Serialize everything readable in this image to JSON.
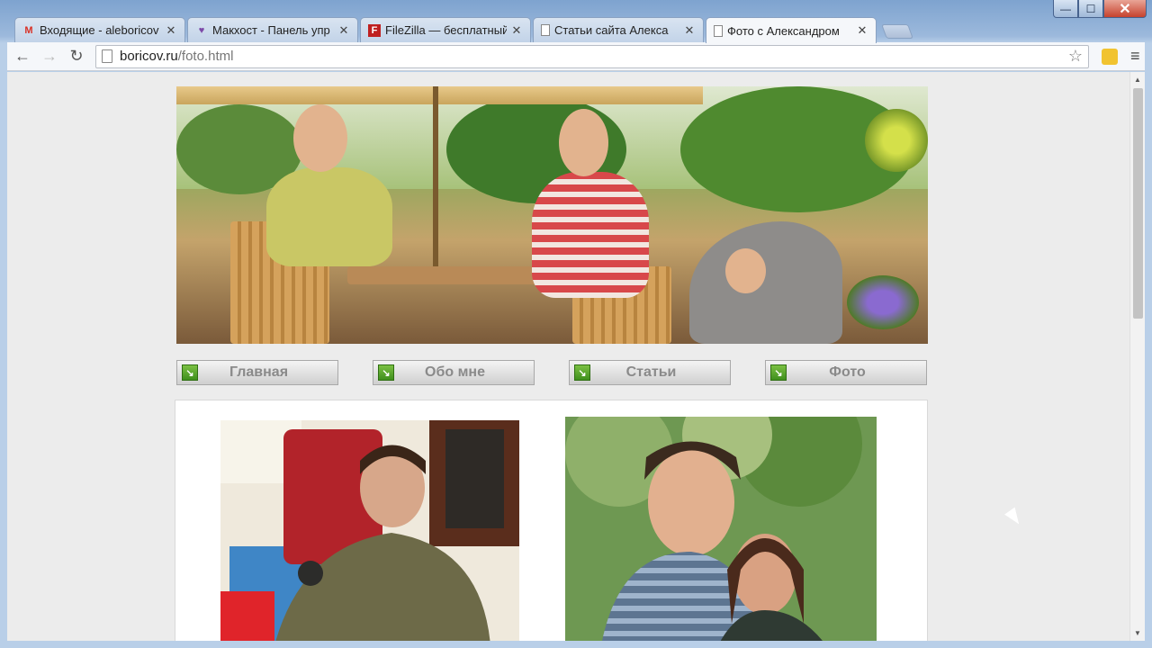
{
  "window": {
    "controls": {
      "minimize": "—",
      "maximize": "☐",
      "close": "✕"
    }
  },
  "tabs": [
    {
      "title": "Входящие - aleboricov",
      "icon": "gmail-icon",
      "active": false
    },
    {
      "title": "Макхост - Панель упр",
      "icon": "heart-icon",
      "active": false
    },
    {
      "title": "FileZilla — бесплатный",
      "icon": "filezilla-icon",
      "active": false
    },
    {
      "title": "Статьи сайта Алекса",
      "icon": "page-icon",
      "active": false
    },
    {
      "title": "Фото с Александром",
      "icon": "page-icon",
      "active": true
    }
  ],
  "toolbar": {
    "back": "←",
    "forward": "→",
    "reload": "↻",
    "url_host": "boricov.ru",
    "url_path": "/foto.html",
    "star": "☆",
    "menu": "≡"
  },
  "site": {
    "nav": [
      {
        "label": "Главная",
        "icon": "arrow-icon"
      },
      {
        "label": "Обо мне",
        "icon": "arrow-icon"
      },
      {
        "label": "Статьи",
        "icon": "arrow-icon"
      },
      {
        "label": "Фото",
        "icon": "arrow-icon"
      }
    ],
    "arrow_glyph": "↘"
  },
  "colors": {
    "frame": "#7ea3cf",
    "nav_accent": "#5aa832",
    "nav_text": "#8a8a8a"
  }
}
